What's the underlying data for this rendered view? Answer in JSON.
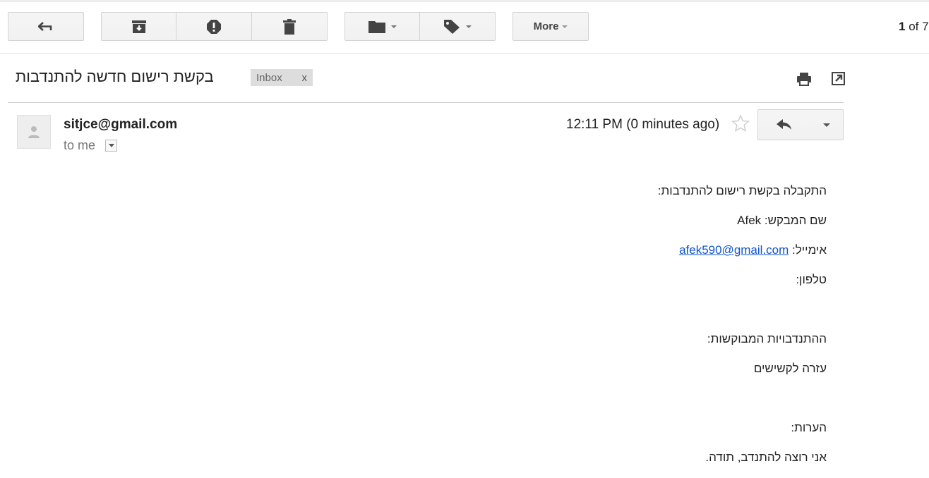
{
  "toolbar": {
    "more_label": "More",
    "pager_current": "1",
    "pager_rest": " of 7"
  },
  "subject": {
    "title": "בקשת רישום חדשה להתנדבות",
    "label": "Inbox",
    "label_close": "x"
  },
  "message": {
    "sender": "sitjce@gmail.com",
    "to": "to me",
    "time": "12:11 PM (0 minutes ago)"
  },
  "body": {
    "line1": "התקבלה בקשת רישום להתנדבות:",
    "name_label": "שם המבקש: ",
    "name_value": "Afek",
    "email_label": "אימייל: ",
    "email_value": "afek590@gmail.com",
    "phone_label": "טלפון:",
    "requests_label": "ההתנדבויות המבוקשות:",
    "requests_value": "עזרה לקשישים",
    "notes_label": "הערות:",
    "notes_value": "אני רוצה להתנדב, תודה."
  },
  "icons": {
    "back": "back-arrow-icon",
    "archive": "archive-icon",
    "spam": "report-spam-icon",
    "delete": "trash-icon",
    "move": "folder-icon",
    "labels": "label-tag-icon",
    "print": "print-icon",
    "popout": "new-window-icon",
    "star": "star-icon",
    "reply": "reply-icon"
  }
}
